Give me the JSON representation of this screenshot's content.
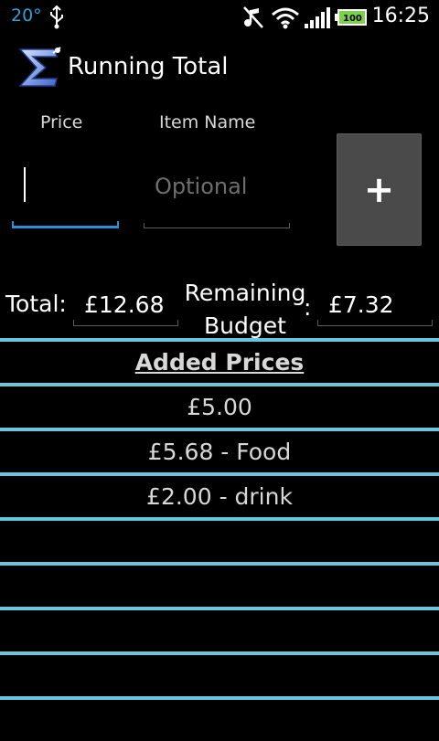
{
  "status_bar": {
    "temperature": "20°",
    "clock": "16:25",
    "battery": "100",
    "icons": [
      "usb-icon",
      "mute-icon",
      "wifi-icon",
      "signal-icon",
      "battery-icon"
    ],
    "colors": {
      "temperature": "#2aa3d8",
      "battery": "#7cd14a"
    }
  },
  "app": {
    "title": "Running Total",
    "icon": "sigma-logo-icon"
  },
  "inputs": {
    "price_label": "Price",
    "price_value": "",
    "item_label": "Item Name",
    "item_placeholder": "Optional",
    "item_value": "",
    "add_button_label": "+"
  },
  "totals": {
    "total_label": "Total:",
    "total_value": "£12.68",
    "remaining_label_line1": "Remaining",
    "remaining_label_line2": "Budget",
    "colon": ":",
    "remaining_value": "£7.32"
  },
  "list": {
    "header": "Added Prices",
    "items": [
      "£5.00",
      "£5.68 - Food",
      "£2.00 - drink",
      "",
      "",
      "",
      "",
      ""
    ],
    "divider_color": "#6ac6de"
  }
}
